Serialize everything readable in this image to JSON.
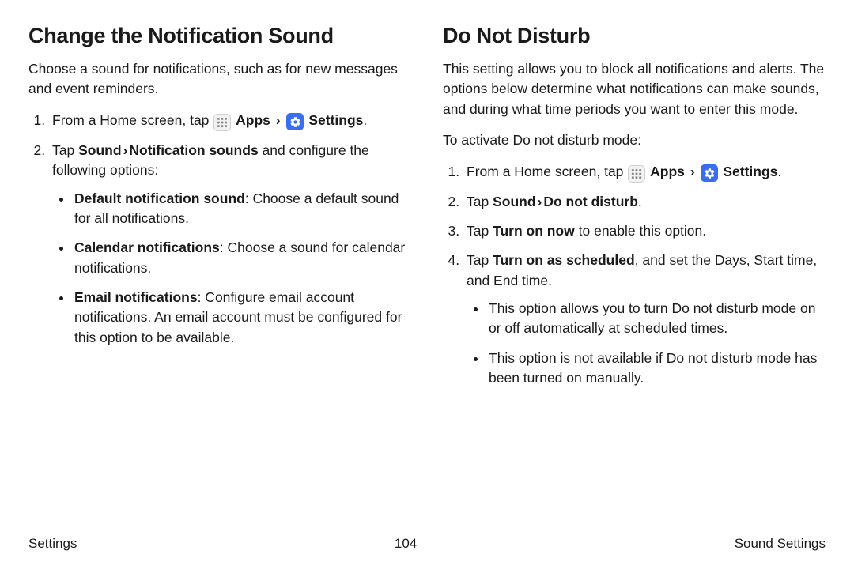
{
  "left": {
    "heading": "Change the Notification Sound",
    "intro": "Choose a sound for notifications, such as for new messages and event reminders.",
    "step1_pre": "From a Home screen, tap ",
    "apps_label": "Apps",
    "settings_label": "Settings",
    "step1_post": ".",
    "step2_pre": "Tap ",
    "step2_bold": "Sound",
    "step2_bold2": "Notification sounds",
    "step2_post": " and configure the following options:",
    "b1_bold": "Default notification sound",
    "b1_rest": ": Choose a default sound for all notifications.",
    "b2_bold": "Calendar notifications",
    "b2_rest": ": Choose a sound for calendar notifications.",
    "b3_bold": "Email notifications",
    "b3_rest": ": Configure email account notifications. An email account must be configured for this option to be available."
  },
  "right": {
    "heading": "Do Not Disturb",
    "intro": "This setting allows you to block all notifications and alerts. The options below determine what notifications can make sounds, and during what time periods you want to enter this mode.",
    "activate": "To activate Do not disturb mode:",
    "step1_pre": "From a Home screen, tap ",
    "apps_label": "Apps",
    "settings_label": "Settings",
    "step1_post": ".",
    "step2_pre": "Tap ",
    "step2_bold": "Sound",
    "step2_bold2": "Do not disturb",
    "step2_post": ".",
    "step3_pre": "Tap ",
    "step3_bold": "Turn on now",
    "step3_post": " to enable this option.",
    "step4_pre": "Tap ",
    "step4_bold": "Turn on as scheduled",
    "step4_post": ", and set the Days, Start time, and End time.",
    "b1": "This option allows you to turn Do not disturb mode on or off automatically at scheduled times.",
    "b2": "This option is not available if Do not disturb mode has been turned on manually."
  },
  "footer": {
    "left": "Settings",
    "center": "104",
    "right": "Sound Settings"
  },
  "chevron": "›"
}
